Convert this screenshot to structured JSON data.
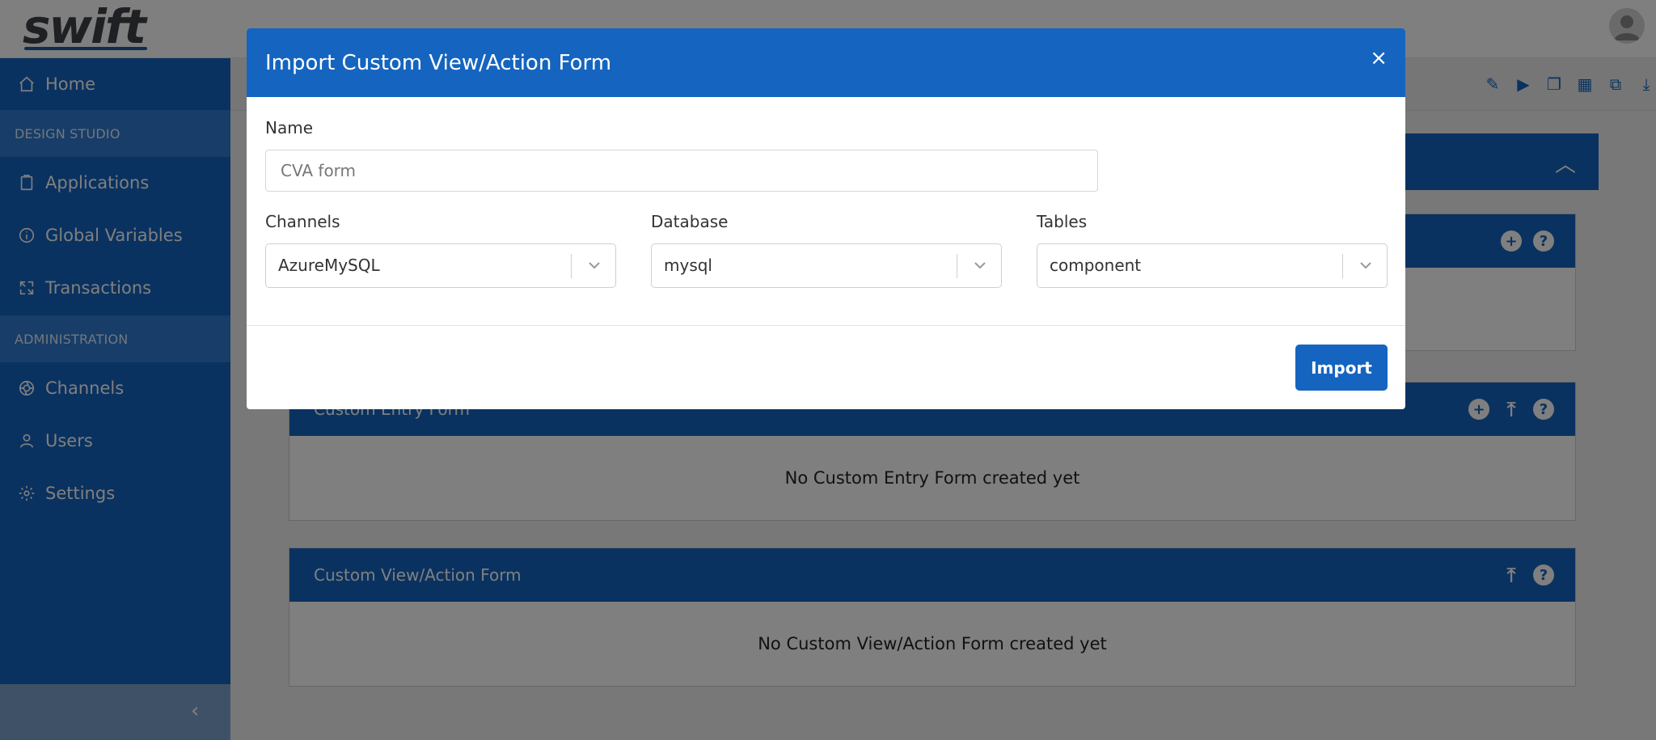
{
  "header": {
    "logo_text": "swift"
  },
  "sidebar": {
    "items": [
      {
        "label": "Home",
        "icon": "home-icon"
      },
      {
        "label": "Applications",
        "icon": "clipboard-icon"
      },
      {
        "label": "Global Variables",
        "icon": "info-icon"
      },
      {
        "label": "Transactions",
        "icon": "expand-icon"
      },
      {
        "label": "Channels",
        "icon": "aperture-icon"
      },
      {
        "label": "Users",
        "icon": "user-icon"
      },
      {
        "label": "Settings",
        "icon": "gear-icon"
      }
    ],
    "sections": [
      "DESIGN STUDIO",
      "ADMINISTRATION"
    ],
    "collapse_glyph": "‹"
  },
  "main": {
    "cards": [
      {
        "title": "Custom Entry Form",
        "empty_text": "No Custom Entry Form created yet"
      },
      {
        "title": "Custom View/Action Form",
        "empty_text": "No Custom View/Action Form created yet"
      }
    ]
  },
  "modal": {
    "title": "Import Custom View/Action Form",
    "close_glyph": "×",
    "name_label": "Name",
    "name_placeholder": "CVA form",
    "channels_label": "Channels",
    "channels_value": "AzureMySQL",
    "database_label": "Database",
    "database_value": "mysql",
    "tables_label": "Tables",
    "tables_value": "component",
    "import_label": "Import"
  },
  "colors": {
    "primary": "#1565c0",
    "section": "#2f7ad0",
    "overlay": "rgba(0,0,0,0.5)"
  }
}
